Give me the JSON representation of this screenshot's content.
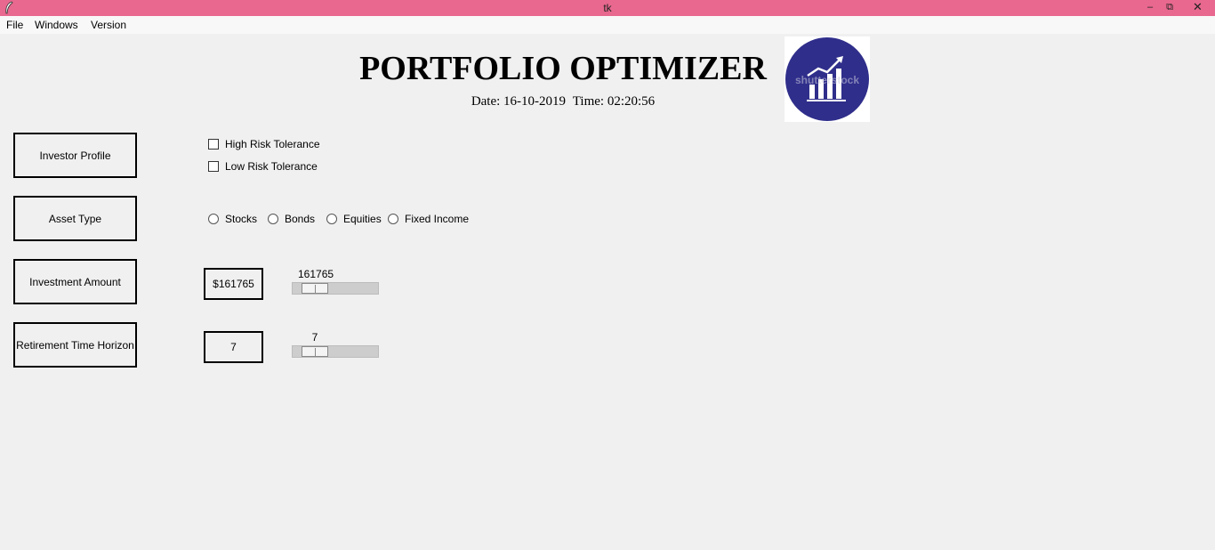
{
  "window": {
    "title": "tk",
    "minimize": "–",
    "maximize": "⧉",
    "close": "✕"
  },
  "menu": [
    "File",
    "Windows",
    "Version"
  ],
  "header": {
    "title": "PORTFOLIO OPTIMIZER",
    "date_label": "Date: 16-10-2019",
    "time_label": "Time: 02:20:56",
    "logo_watermark": "shutterstock",
    "logo_colors": {
      "circle": "#2f2e8b",
      "chart": "#ffffff"
    }
  },
  "buttons": {
    "investor_profile": "Investor Profile",
    "asset_type": "Asset Type",
    "investment_amount": "Investment Amount",
    "retirement_horizon": "Retirement Time Horizon"
  },
  "risk_options": [
    {
      "label": "High Risk Tolerance",
      "checked": false
    },
    {
      "label": "Low Risk Tolerance",
      "checked": false
    }
  ],
  "asset_options": [
    {
      "label": "Stocks",
      "selected": false
    },
    {
      "label": "Bonds",
      "selected": false
    },
    {
      "label": "Equities",
      "selected": false
    },
    {
      "label": "Fixed Income",
      "selected": false
    }
  ],
  "investment": {
    "display": "$161765",
    "scale_value": "161765"
  },
  "retirement": {
    "display": "7",
    "scale_value": "7"
  }
}
